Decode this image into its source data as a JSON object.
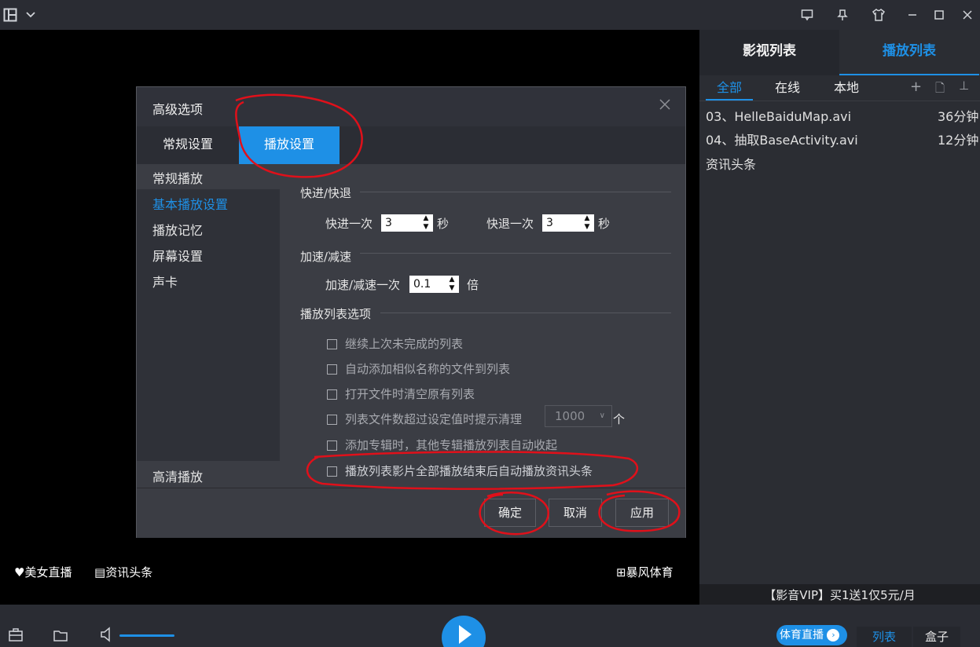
{
  "titlebar": {
    "icons": [
      "layout-icon",
      "chevron-down-icon",
      "feedback-icon",
      "pin-icon",
      "skin-icon",
      "minimize-icon",
      "maximize-icon",
      "close-icon"
    ]
  },
  "right_panel": {
    "tabs": [
      {
        "label": "影视列表"
      },
      {
        "label": "播放列表"
      }
    ],
    "subtabs": [
      {
        "label": "全部"
      },
      {
        "label": "在线"
      },
      {
        "label": "本地"
      }
    ],
    "playlist": [
      {
        "title": "03、HelleBaiduMap.avi",
        "duration": "36分钟"
      },
      {
        "title": "04、抽取BaseActivity.avi",
        "duration": "12分钟"
      },
      {
        "title": "资讯头条",
        "duration": ""
      }
    ],
    "vip_text": "【影音VIP】买1送1仅5元/月"
  },
  "overlay_links": {
    "left1": "美女直播",
    "left2": "资讯头条",
    "right": "暴风体育"
  },
  "controls": {
    "sports_live": "体育直播",
    "list": "列表",
    "box": "盒子"
  },
  "dialog": {
    "title": "高级选项",
    "tabs": [
      {
        "label": "常规设置"
      },
      {
        "label": "播放设置"
      }
    ],
    "side": {
      "group1": "常规播放",
      "items": [
        {
          "label": "基本播放设置"
        },
        {
          "label": "播放记忆"
        },
        {
          "label": "屏幕设置"
        },
        {
          "label": "声卡"
        }
      ],
      "group2": "高清播放"
    },
    "seek": {
      "title": "快进/快退",
      "forward_label": "快进一次",
      "forward_value": "3",
      "backward_label": "快退一次",
      "backward_value": "3",
      "unit": "秒"
    },
    "speed": {
      "title": "加速/减速",
      "label": "加速/减速一次",
      "value": "0.1",
      "unit": "倍"
    },
    "playlist_options": {
      "title": "播放列表选项",
      "items": [
        {
          "label": "继续上次未完成的列表",
          "checked": false
        },
        {
          "label": "自动添加相似名称的文件到列表",
          "checked": false
        },
        {
          "label": "打开文件时清空原有列表",
          "checked": false
        },
        {
          "label": "列表文件数超过设定值时提示清理",
          "checked": false
        },
        {
          "label": "添加专辑时，其他专辑播放列表自动收起",
          "checked": false
        },
        {
          "label": "播放列表影片全部播放结束后自动播放资讯头条",
          "checked": false
        }
      ],
      "limit_value": "1000",
      "limit_unit": "个"
    },
    "buttons": {
      "ok": "确定",
      "cancel": "取消",
      "apply": "应用"
    }
  },
  "colors": {
    "accent": "#1e90e6",
    "annotation": "#e0101a"
  }
}
